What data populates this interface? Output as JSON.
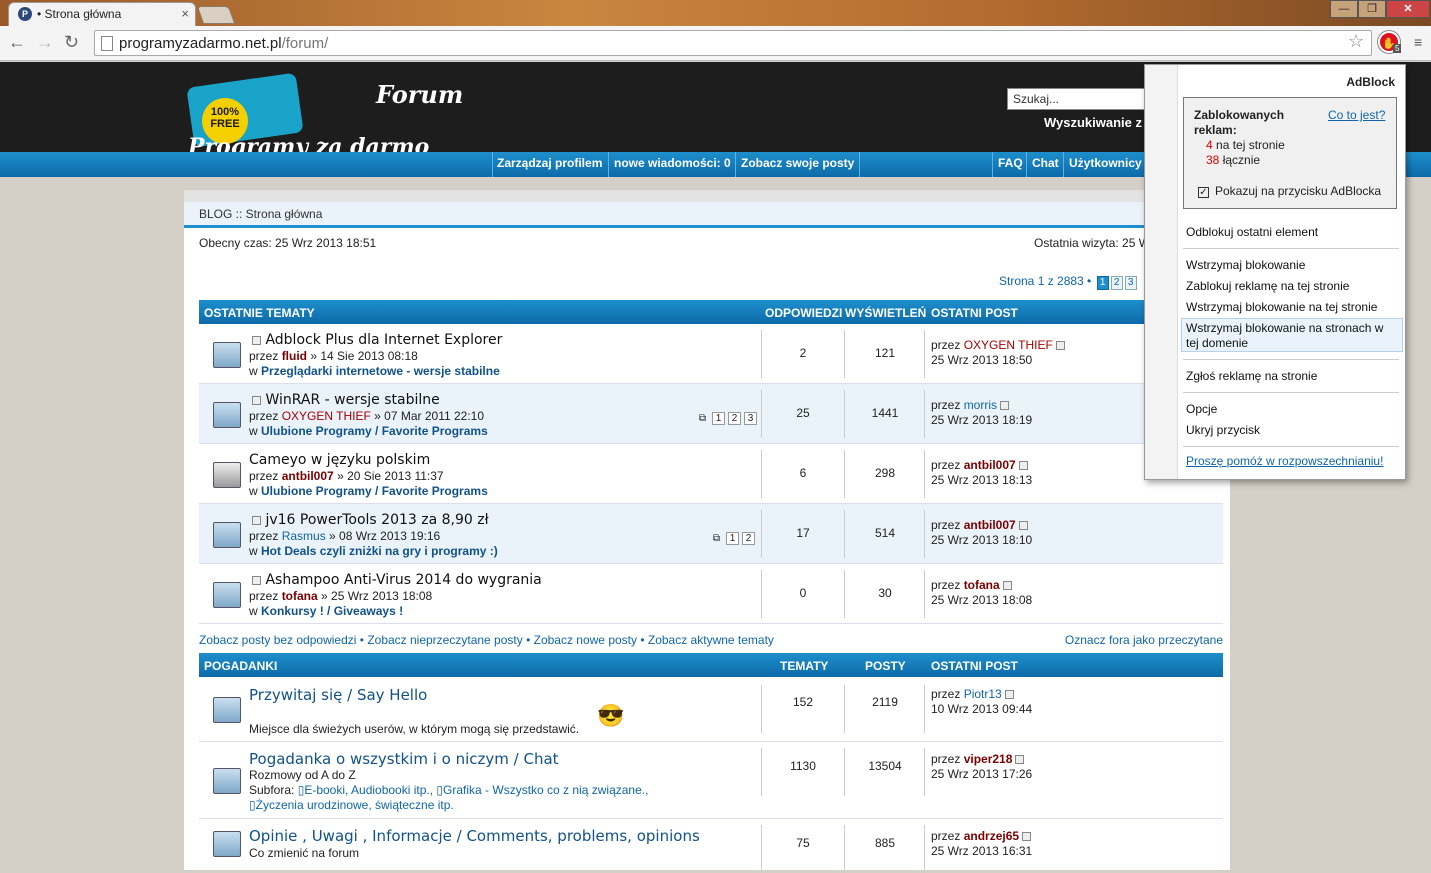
{
  "browser": {
    "tab_title": "• Strona główna",
    "tab_favicon": "P",
    "url_host": "programyzadarmo.net.pl",
    "url_path": "/forum/",
    "adblock_badge": "5",
    "win_min": "—",
    "win_max": "❐",
    "win_close": "✕"
  },
  "header": {
    "logo_forum": "Forum",
    "logo_title": "Programy za darmo",
    "logo_seal": "100% FREE",
    "search_placeholder": "Szukaj...",
    "adv_search": "Wyszukiwanie z",
    "nav_left": [
      "Zarządzaj profilem",
      "nowe wiadomości: 0",
      "Zobacz swoje posty"
    ],
    "nav_right": [
      "FAQ",
      "Chat",
      "Użytkownicy"
    ]
  },
  "page": {
    "breadcrumb": "BLOG :: Strona główna",
    "current_time": "Obecny czas: 25 Wrz 2013 18:51",
    "last_visit": "Ostatnia wizyta: 25 W",
    "pagination_label": "Strona 1 z 2883 •",
    "pages": [
      "1",
      "2",
      "3"
    ]
  },
  "topics_table": {
    "headers": [
      "OSTATNIE TEMATY",
      "ODPOWIEDZI",
      "WYŚWIETLEŃ",
      "OSTATNI POST"
    ],
    "rows": [
      {
        "title": "Adblock Plus dla Internet Explorer",
        "by": "przez",
        "author": "fluid",
        "date": "» 14 Sie 2013 08:18",
        "in": "w",
        "forum": "Przeglądarki internetowe - wersje stabilne",
        "replies": "2",
        "views": "121",
        "last_by": "OXYGEN THIEF",
        "last_date": "25 Wrz 2013 18:50",
        "pages": []
      },
      {
        "title": "WinRAR - wersje stabilne",
        "by": "przez",
        "author": "OXYGEN THIEF",
        "date": "» 07 Mar 2011 22:10",
        "in": "w",
        "forum": "Ulubione Programy / Favorite Programs",
        "replies": "25",
        "views": "1441",
        "last_by": "morris",
        "last_date": "25 Wrz 2013 18:19",
        "pages": [
          "1",
          "2",
          "3"
        ]
      },
      {
        "title": "Cameyo w języku polskim",
        "by": "przez",
        "author": "antbil007",
        "date": "» 20 Sie 2013 11:37",
        "in": "w",
        "forum": "Ulubione Programy / Favorite Programs",
        "replies": "6",
        "views": "298",
        "last_by": "antbil007",
        "last_date": "25 Wrz 2013 18:13",
        "pages": []
      },
      {
        "title": "jv16 PowerTools 2013 za 8,90 zł",
        "by": "przez",
        "author": "Rasmus",
        "date": "» 08 Wrz 2013 19:16",
        "in": "w",
        "forum": "Hot Deals czyli zniżki na gry i programy :)",
        "replies": "17",
        "views": "514",
        "last_by": "antbil007",
        "last_date": "25 Wrz 2013 18:10",
        "pages": [
          "1",
          "2"
        ]
      },
      {
        "title": "Ashampoo Anti-Virus 2014 do wygrania",
        "by": "przez",
        "author": "tofana",
        "date": "» 25 Wrz 2013 18:08",
        "in": "w",
        "forum": "Konkursy ! / Giveaways !",
        "replies": "0",
        "views": "30",
        "last_by": "tofana",
        "last_date": "25 Wrz 2013 18:08",
        "pages": []
      }
    ]
  },
  "quick_links": {
    "items": [
      "Zobacz posty bez odpowiedzi",
      "Zobacz nieprzeczytane posty",
      "Zobacz nowe posty",
      "Zobacz aktywne tematy"
    ],
    "sep": " • ",
    "mark_read": "Oznacz fora jako przeczytane"
  },
  "forums_table": {
    "headers": [
      "POGADANKI",
      "TEMATY",
      "POSTY",
      "OSTATNI POST"
    ],
    "rows": [
      {
        "title": "Przywitaj się / Say Hello",
        "desc": "Miejsce dla świeżych userów, w którym mogą się przedstawić.",
        "topics": "152",
        "posts": "2119",
        "by": "przez",
        "last_by": "Piotr13",
        "last_date": "10 Wrz 2013 09:44"
      },
      {
        "title": "Pogadanka o wszystkim i o niczym / Chat",
        "desc": "Rozmowy od A do Z",
        "subforums_label": "Subfora:",
        "subforums": [
          "E-booki, Audiobooki itp.,",
          "Grafika - Wszystko co z nią związane.,",
          "Życzenia urodzinowe, świąteczne itp."
        ],
        "topics": "1130",
        "posts": "13504",
        "by": "przez",
        "last_by": "viper218",
        "last_date": "25 Wrz 2013 17:26"
      },
      {
        "title": "Opinie , Uwagi , Informacje / Comments, problems, opinions",
        "desc": "Co zmienić na forum",
        "topics": "75",
        "posts": "885",
        "by": "przez",
        "last_by": "andrzej65",
        "last_date": "25 Wrz 2013 16:31"
      }
    ]
  },
  "adblock_popup": {
    "title": "AdBlock",
    "blocked_label": "Zablokowanych reklam:",
    "what_is": "Co to jest?",
    "page_count": "4",
    "page_label": "na tej stronie",
    "total_count": "38",
    "total_label": "łącznie",
    "show_on_button": "Pokazuj na przycisku AdBlocka",
    "menu": [
      "Odblokuj ostatni element",
      "Wstrzymaj blokowanie",
      "Zablokuj reklamę na tej stronie",
      "Wstrzymaj blokowanie na tej stronie",
      "Wstrzymaj blokowanie na stronach w tej domenie",
      "Zgłoś reklamę na stronie",
      "Opcje",
      "Ukryj przycisk"
    ],
    "help_link": "Proszę pomóż w rozpowszechnianiu!"
  },
  "colors": {
    "accent": "#1d8fcc",
    "header_bg": "#1d1d1d",
    "link": "#1066a8",
    "alert_red": "#aa0000"
  }
}
